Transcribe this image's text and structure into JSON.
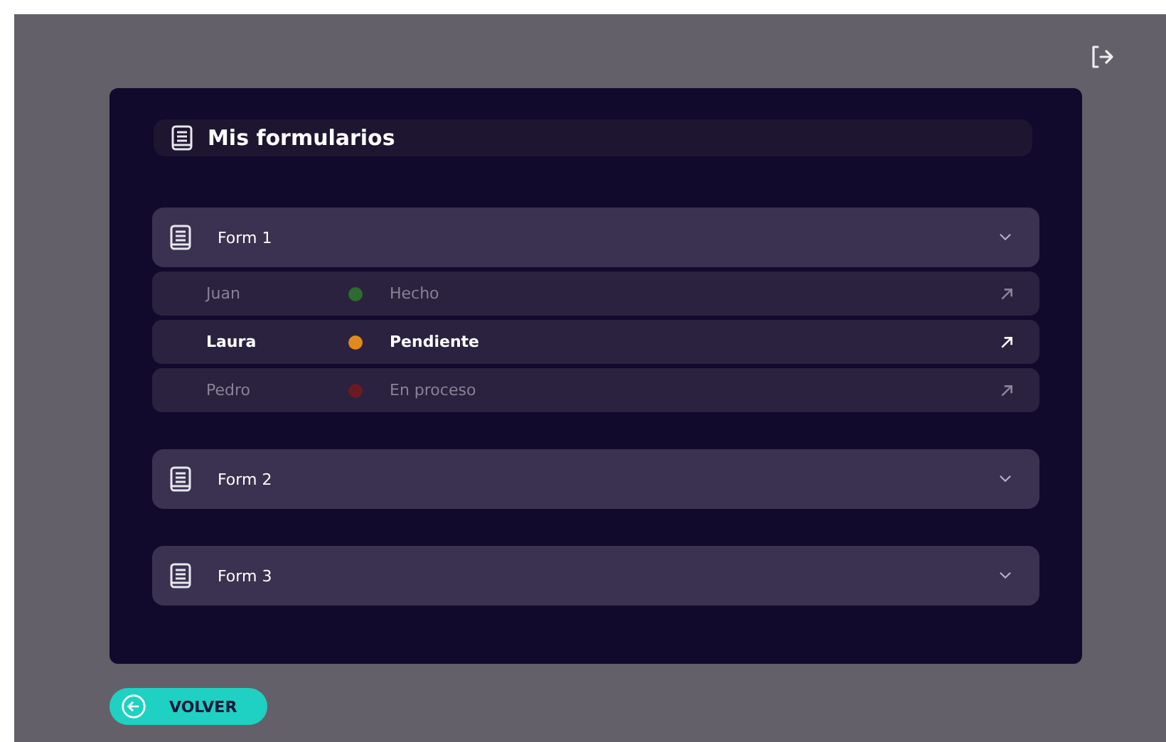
{
  "header": {
    "title": "Mis formularios"
  },
  "forms": [
    {
      "name": "Form 1",
      "responses": [
        {
          "person": "Juan",
          "status": "Hecho",
          "color": "#2e6b2e",
          "selected": false
        },
        {
          "person": "Laura",
          "status": "Pendiente",
          "color": "#e08a1c",
          "selected": true
        },
        {
          "person": "Pedro",
          "status": "En proceso",
          "color": "#6a1a22",
          "selected": false
        }
      ]
    },
    {
      "name": "Form 2"
    },
    {
      "name": "Form 3"
    }
  ],
  "back_button": {
    "label": "VOLVER"
  }
}
